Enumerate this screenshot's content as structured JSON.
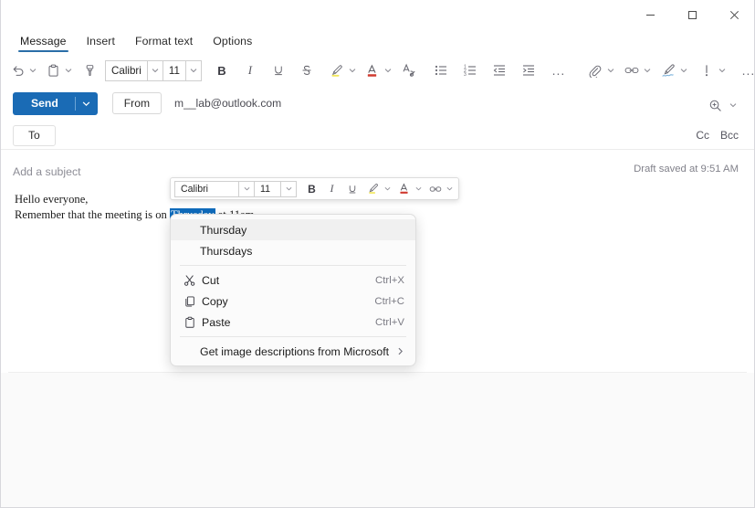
{
  "window": {
    "controls": [
      {
        "name": "minimize",
        "glyph": "minimize-icon"
      },
      {
        "name": "maximize",
        "glyph": "maximize-icon"
      },
      {
        "name": "close",
        "glyph": "close-icon"
      }
    ]
  },
  "tabs": [
    {
      "label": "Message",
      "active": true
    },
    {
      "label": "Insert",
      "active": false
    },
    {
      "label": "Format text",
      "active": false
    },
    {
      "label": "Options",
      "active": false
    }
  ],
  "accent_color": "#2a6ea8",
  "send_color": "#1a6bb5",
  "selection_color": "#0f6cbd",
  "ribbon": {
    "undo": "undo-icon",
    "paste": "paste-icon",
    "format_painter": "format-painter-icon",
    "font_name": "Calibri",
    "font_size": "11",
    "bold": "B",
    "italic": "I",
    "underline": "U",
    "strikethrough": "S",
    "highlight": "highlighter-icon",
    "font_color": "font-color-icon",
    "clear_formatting": "clear-formatting-icon",
    "bullets": "bulleted-list-icon",
    "numbering": "numbered-list-icon",
    "decrease_indent": "decrease-indent-icon",
    "increase_indent": "increase-indent-icon",
    "more_format": "...",
    "attach": "attach-icon",
    "link": "link-icon",
    "signature": "signature-icon",
    "importance": "importance-icon",
    "more_options": "...",
    "zoom": "zoom-icon"
  },
  "compose": {
    "send_label": "Send",
    "from_label": "From",
    "from_address": "m__lab@outlook.com",
    "to_label": "To",
    "to_value": "",
    "cc_label": "Cc",
    "bcc_label": "Bcc",
    "subject_placeholder": "Add a subject",
    "subject_value": "",
    "draft_status": "Draft saved at 9:51 AM",
    "body_line1": "Hello everyone,",
    "body_line2_before": "Remember that the meeting is on ",
    "body_selected_word": "Thrusday",
    "body_line2_after": " at 11am"
  },
  "mini_toolbar": {
    "font_name": "Calibri",
    "font_size": "11",
    "bold": "B",
    "italic": "I",
    "underline": "U",
    "highlight": "highlighter-icon",
    "font_color": "font-color-icon",
    "link": "link-icon"
  },
  "context_menu": {
    "suggestions": [
      {
        "label": "Thursday",
        "hover": true
      },
      {
        "label": "Thursdays",
        "hover": false
      }
    ],
    "items": [
      {
        "label": "Cut",
        "accel": "C",
        "shortcut": "Ctrl+X",
        "icon": "scissors-icon"
      },
      {
        "label": "Copy",
        "accel": "C",
        "shortcut": "Ctrl+C",
        "icon": "copy-icon"
      },
      {
        "label": "Paste",
        "accel": "P",
        "shortcut": "Ctrl+V",
        "icon": "paste-icon"
      }
    ],
    "submenu_item": {
      "label": "Get image descriptions from Microsoft",
      "chevron": "chevron-right-icon"
    }
  }
}
